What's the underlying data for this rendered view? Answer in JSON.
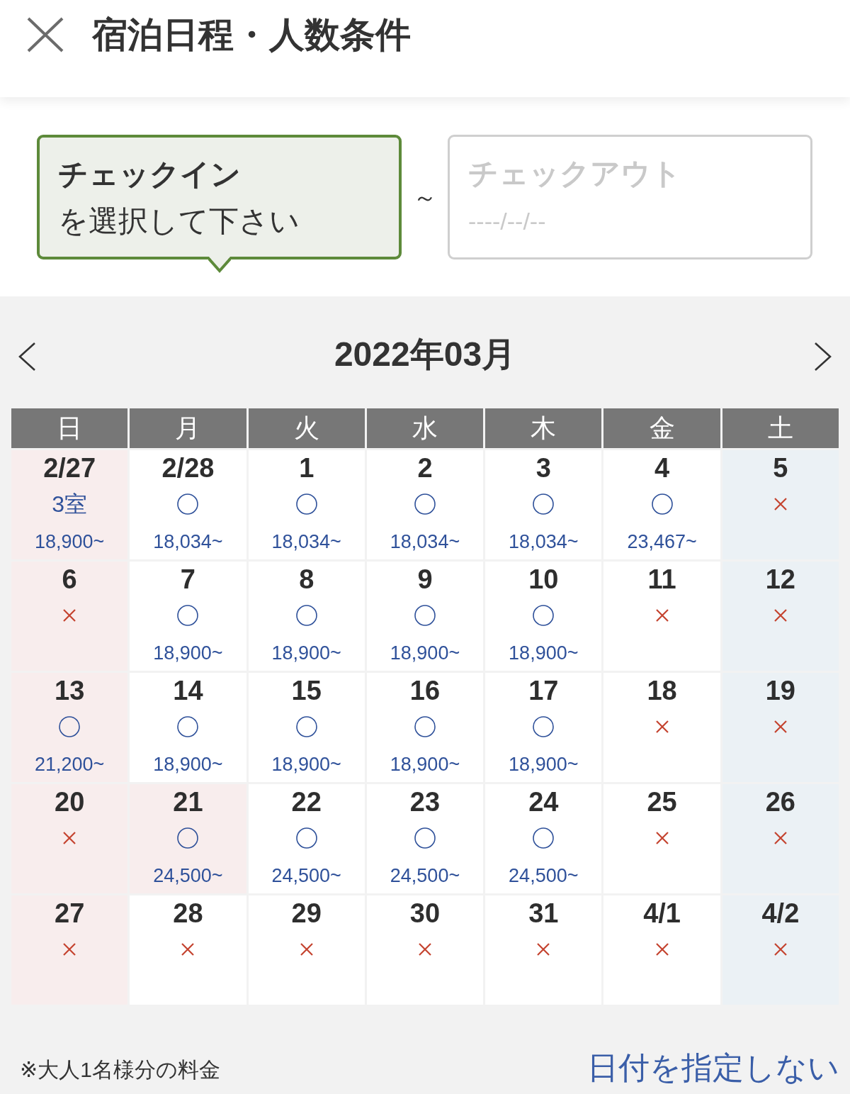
{
  "header": {
    "title": "宿泊日程・人数条件"
  },
  "date_fields": [
    {
      "label": "チェックイン",
      "prompt": "を選択して下さい",
      "selected": true
    },
    {
      "label": "チェックアウト",
      "placeholder": "----/--/--",
      "selected": false
    }
  ],
  "separator": "～",
  "calendar": {
    "month": "2022年03月",
    "weekdays": [
      "日",
      "月",
      "火",
      "水",
      "木",
      "金",
      "土"
    ],
    "weeks": [
      {
        "days": [
          {
            "date": "2/27",
            "kind": "holiday",
            "available": true,
            "rooms": "3室",
            "price": "18,900~"
          },
          {
            "date": "2/28",
            "kind": "weekday",
            "available": true,
            "price": "18,034~"
          },
          {
            "date": "1",
            "kind": "weekday",
            "available": true,
            "price": "18,034~"
          },
          {
            "date": "2",
            "kind": "weekday",
            "available": true,
            "price": "18,034~"
          },
          {
            "date": "3",
            "kind": "weekday",
            "available": true,
            "price": "18,034~"
          },
          {
            "date": "4",
            "kind": "weekday",
            "available": true,
            "price": "23,467~"
          },
          {
            "date": "5",
            "kind": "saturday",
            "available": false
          }
        ]
      },
      {
        "days": [
          {
            "date": "6",
            "kind": "holiday",
            "available": false
          },
          {
            "date": "7",
            "kind": "weekday",
            "available": true,
            "price": "18,900~"
          },
          {
            "date": "8",
            "kind": "weekday",
            "available": true,
            "price": "18,900~"
          },
          {
            "date": "9",
            "kind": "weekday",
            "available": true,
            "price": "18,900~"
          },
          {
            "date": "10",
            "kind": "weekday",
            "available": true,
            "price": "18,900~"
          },
          {
            "date": "11",
            "kind": "weekday",
            "available": false
          },
          {
            "date": "12",
            "kind": "saturday",
            "available": false
          }
        ]
      },
      {
        "days": [
          {
            "date": "13",
            "kind": "holiday",
            "available": true,
            "price": "21,200~"
          },
          {
            "date": "14",
            "kind": "weekday",
            "available": true,
            "price": "18,900~"
          },
          {
            "date": "15",
            "kind": "weekday",
            "available": true,
            "price": "18,900~"
          },
          {
            "date": "16",
            "kind": "weekday",
            "available": true,
            "price": "18,900~"
          },
          {
            "date": "17",
            "kind": "weekday",
            "available": true,
            "price": "18,900~"
          },
          {
            "date": "18",
            "kind": "weekday",
            "available": false
          },
          {
            "date": "19",
            "kind": "saturday",
            "available": false
          }
        ]
      },
      {
        "days": [
          {
            "date": "20",
            "kind": "holiday",
            "available": false
          },
          {
            "date": "21",
            "kind": "holiday",
            "available": true,
            "price": "24,500~"
          },
          {
            "date": "22",
            "kind": "weekday",
            "available": true,
            "price": "24,500~"
          },
          {
            "date": "23",
            "kind": "weekday",
            "available": true,
            "price": "24,500~"
          },
          {
            "date": "24",
            "kind": "weekday",
            "available": true,
            "price": "24,500~"
          },
          {
            "date": "25",
            "kind": "weekday",
            "available": false
          },
          {
            "date": "26",
            "kind": "saturday",
            "available": false
          }
        ]
      },
      {
        "days": [
          {
            "date": "27",
            "kind": "holiday",
            "available": false
          },
          {
            "date": "28",
            "kind": "weekday",
            "available": false
          },
          {
            "date": "29",
            "kind": "weekday",
            "available": false
          },
          {
            "date": "30",
            "kind": "weekday",
            "available": false
          },
          {
            "date": "31",
            "kind": "weekday",
            "available": false
          },
          {
            "date": "4/1",
            "kind": "weekday",
            "available": false
          },
          {
            "date": "4/2",
            "kind": "saturday",
            "available": false
          }
        ]
      }
    ]
  },
  "footer": {
    "note": "※大人1名様分の料金",
    "link": "日付を指定しない"
  }
}
